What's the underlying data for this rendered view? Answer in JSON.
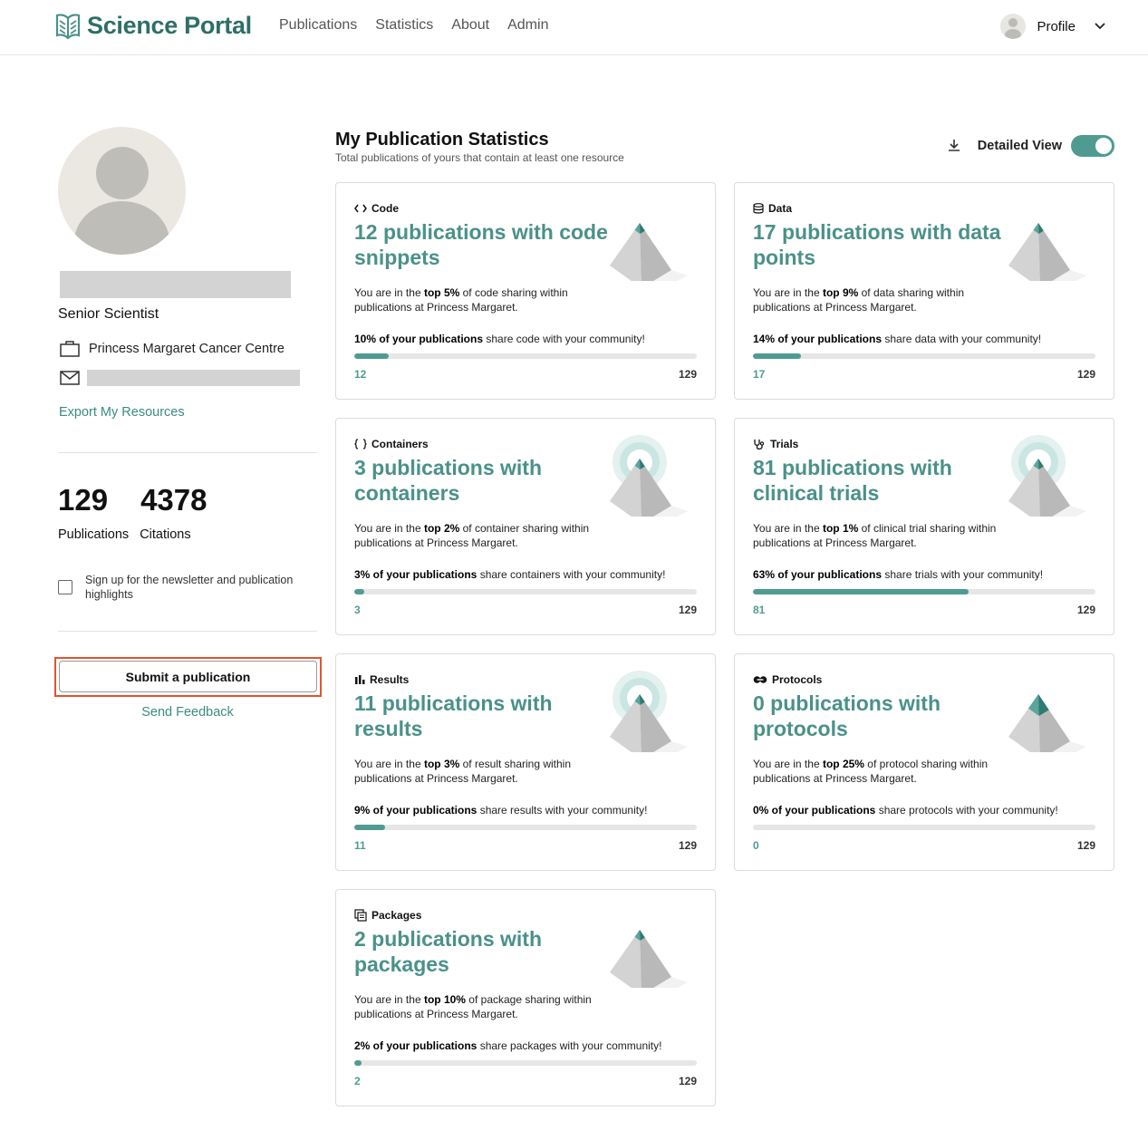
{
  "brand": {
    "name": "Science Portal",
    "accent": "#4a918a",
    "dark_accent": "#2e6f67"
  },
  "nav": {
    "items": [
      "Publications",
      "Statistics",
      "About",
      "Admin"
    ]
  },
  "profile_menu": {
    "label": "Profile",
    "icon": "chevron-down-icon"
  },
  "sidebar": {
    "role": "Senior Scientist",
    "institution": "Princess Margaret Cancer Centre",
    "export_link": "Export My Resources",
    "publications_count": "129",
    "publications_label": "Publications",
    "citations_count": "4378",
    "citations_label": "Citations",
    "newsletter_label": "Sign up for the newsletter and publication highlights",
    "newsletter_checked": false,
    "submit_label": "Submit a publication",
    "feedback_label": "Send Feedback"
  },
  "main": {
    "title": "My Publication Statistics",
    "subtitle": "Total publications of yours that contain at least one resource",
    "detailed_view_label": "Detailed View",
    "detailed_view_on": true
  },
  "cards": [
    {
      "type": "Code",
      "icon": "code-icon",
      "headline": "12 publications with code snippets",
      "rank_pre": "You are in the ",
      "rank_bold": "top 5%",
      "rank_post": " of code sharing within publications at Princess Margaret.",
      "share_bold": "10% of your publications",
      "share_post": " share code with your community!",
      "count": "12",
      "total": "129",
      "fraction": 0.1,
      "highlight": false
    },
    {
      "type": "Data",
      "icon": "database-icon",
      "headline": "17 publications with data points",
      "rank_pre": "You are in the ",
      "rank_bold": "top 9%",
      "rank_post": " of data sharing within publications at Princess Margaret.",
      "share_bold": "14% of your publications",
      "share_post": " share data with your community!",
      "count": "17",
      "total": "129",
      "fraction": 0.14,
      "highlight": false
    },
    {
      "type": "Containers",
      "icon": "braces-icon",
      "headline": "3 publications with containers",
      "rank_pre": "You are in the ",
      "rank_bold": "top 2%",
      "rank_post": " of container sharing within publications at Princess Margaret.",
      "share_bold": "3% of your publications",
      "share_post": " share containers with your community!",
      "count": "3",
      "total": "129",
      "fraction": 0.03,
      "highlight": true
    },
    {
      "type": "Trials",
      "icon": "stethoscope-icon",
      "headline": "81 publications with clinical trials",
      "rank_pre": "You are in the ",
      "rank_bold": "top 1%",
      "rank_post": " of clinical trial sharing within publications at Princess Margaret.",
      "share_bold": "63% of your publications",
      "share_post": " share trials with your community!",
      "count": "81",
      "total": "129",
      "fraction": 0.63,
      "highlight": true
    },
    {
      "type": "Results",
      "icon": "bar-chart-icon",
      "headline": "11 publications with results",
      "rank_pre": "You are in the ",
      "rank_bold": "top 3%",
      "rank_post": " of result sharing within publications at Princess Margaret.",
      "share_bold": "9% of your publications",
      "share_post": " share results with your community!",
      "count": "11",
      "total": "129",
      "fraction": 0.09,
      "highlight": true
    },
    {
      "type": "Protocols",
      "icon": "pills-icon",
      "headline": "0 publications with protocols",
      "rank_pre": "You are in the ",
      "rank_bold": "top 25%",
      "rank_post": " of protocol sharing within publications at Princess Margaret.",
      "share_bold": "0% of your publications",
      "share_post": " share protocols with your community!",
      "count": "0",
      "total": "129",
      "fraction": 0,
      "highlight": false
    },
    {
      "type": "Packages",
      "icon": "package-icon",
      "headline": "2 publications with packages",
      "rank_pre": "You are in the ",
      "rank_bold": "top 10%",
      "rank_post": " of package sharing within publications at Princess Margaret.",
      "share_bold": "2% of your publications",
      "share_post": " share packages with your community!",
      "count": "2",
      "total": "129",
      "fraction": 0.02,
      "highlight": false
    }
  ]
}
